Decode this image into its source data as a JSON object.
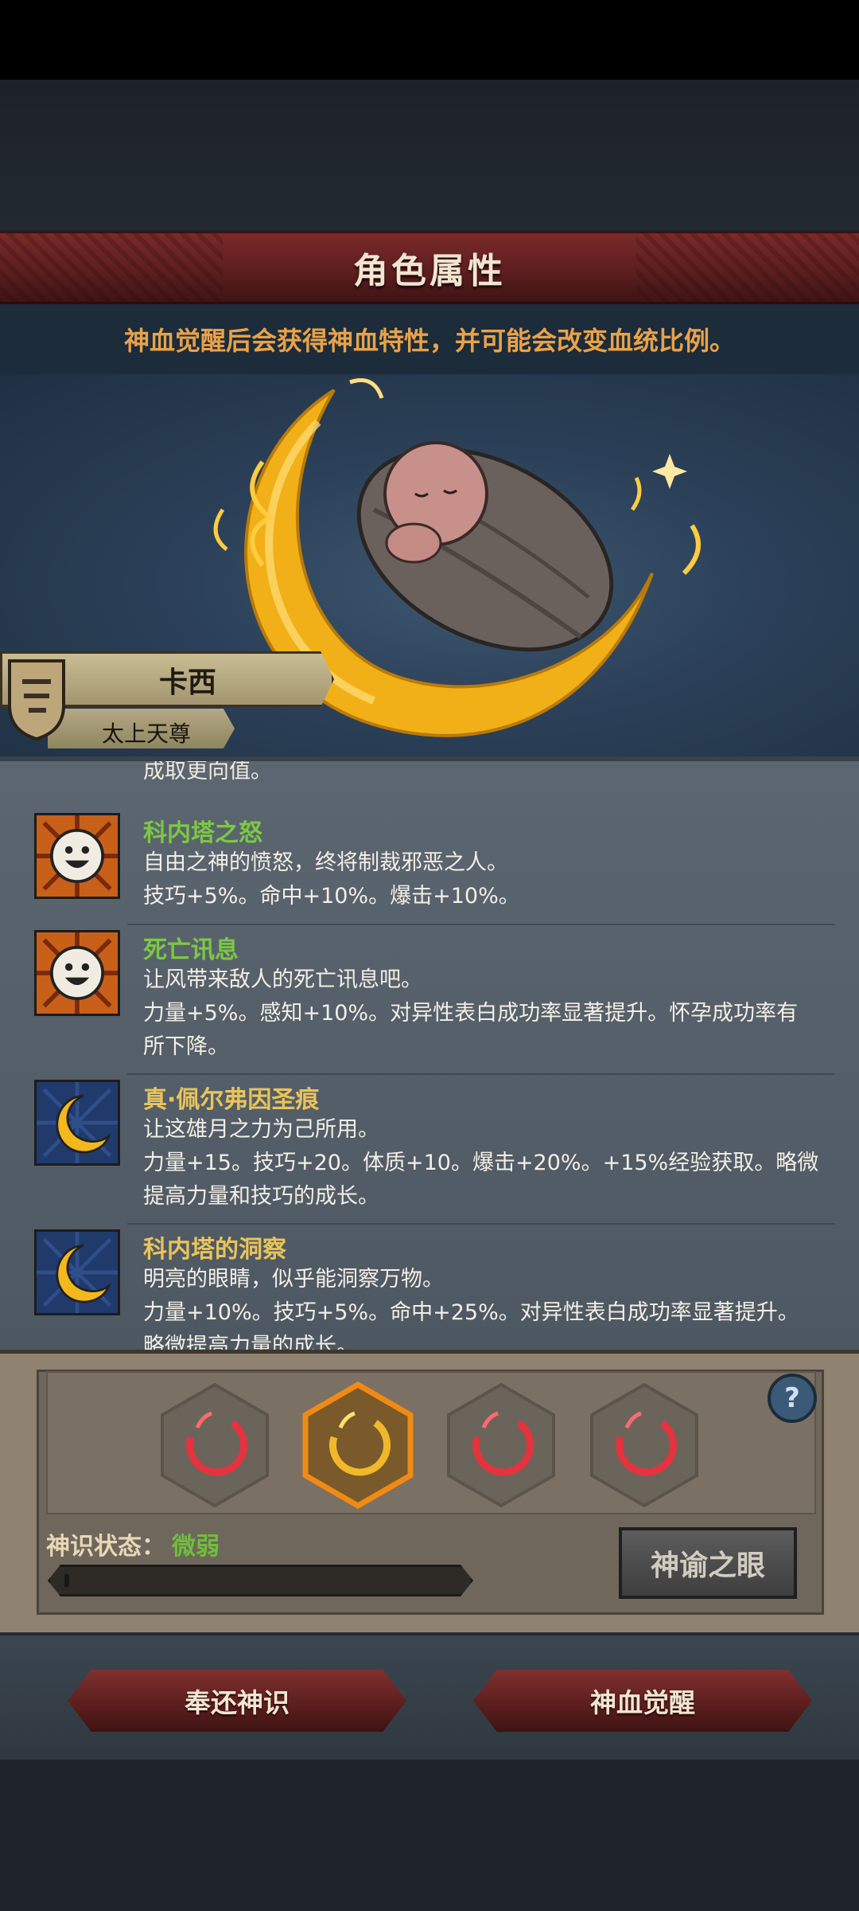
{
  "header": {
    "title": "角色属性"
  },
  "notice": "神血觉醒后会获得神血特性，并可能会改变血统比例。",
  "character": {
    "name": "卡西",
    "rank": "太上天尊"
  },
  "list": {
    "cut_text": "成取更向值。",
    "traits": [
      {
        "name": "科内塔之怒",
        "name_color": "#7cc843",
        "icon": "smiley-sunburst-icon",
        "lines": [
          "自由之神的愤怒，终将制裁邪恶之人。",
          "技巧+5%。命中+10%。爆击+10%。"
        ]
      },
      {
        "name": "死亡讯息",
        "name_color": "#7cc843",
        "icon": "smiley-sunburst-icon",
        "lines": [
          "让风带来敌人的死亡讯息吧。",
          "力量+5%。感知+10%。对异性表白成功率显著提升。怀孕成功率有",
          "所下降。"
        ]
      },
      {
        "name": "真·佩尔弗因圣痕",
        "name_color": "#e8c45a",
        "icon": "golden-moon-icon",
        "lines": [
          "让这雄月之力为己所用。",
          "力量+15。技巧+20。体质+10。爆击+20%。+15%经验获取。略微",
          "提高力量和技巧的成长。"
        ]
      },
      {
        "name": "科内塔的洞察",
        "name_color": "#e8c45a",
        "icon": "golden-moon-icon",
        "lines": [
          "明亮的眼睛，似乎能洞察万物。",
          "力量+10%。技巧+5%。命中+25%。对异性表白成功率显著提升。",
          "略微提高力量的成长。"
        ]
      }
    ]
  },
  "awaken": {
    "slots": [
      {
        "color": "red",
        "selected": false
      },
      {
        "color": "gold",
        "selected": true
      },
      {
        "color": "red",
        "selected": false
      },
      {
        "color": "red",
        "selected": false
      }
    ],
    "help_label": "?",
    "sense_label": "神识状态：",
    "sense_value": "微弱",
    "sense_progress": 0.01,
    "oracle_button": "神谕之眼"
  },
  "actions": {
    "return_label": "奉还神识",
    "awaken_label": "神血觉醒"
  }
}
